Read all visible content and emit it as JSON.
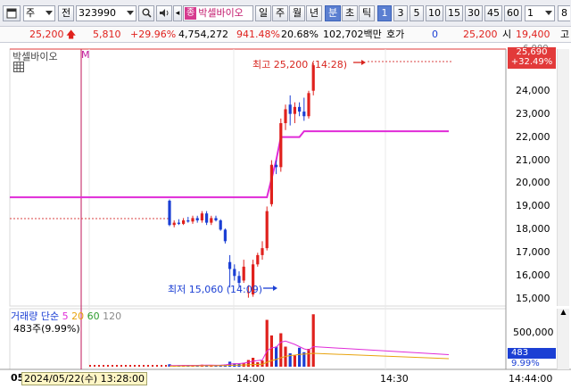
{
  "toolbar": {
    "market": "주",
    "chart_type": "전",
    "code": "323990",
    "sector_tag": "종",
    "stock_name": "박셀바이오",
    "periods": [
      "일",
      "주",
      "월",
      "년",
      "분",
      "초",
      "틱"
    ],
    "active_period": "분",
    "intervals": [
      "1",
      "3",
      "5",
      "10",
      "15",
      "30",
      "45",
      "60"
    ],
    "active_interval": "1",
    "multiplier": "1",
    "extra": "8"
  },
  "quote": {
    "price": "25,200",
    "change": "5,810",
    "change_pct": "+29.96%",
    "volume": "4,754,272",
    "vol_ratio": "941.48%",
    "turnover": "20.68%",
    "amount": "102,702백만",
    "hoga_label": "호가",
    "hoga_value": "0",
    "hoga_price": "25,200",
    "open_label": "시",
    "open_value": "19,400",
    "high_label": "고"
  },
  "chart": {
    "legend_name": "박셀바이오",
    "legend_flag": "M",
    "high_annotation": "최고 25,200 (14:28)",
    "low_annotation": "최저 15,060 (14:09)",
    "price_ticks": [
      "24,000",
      "23,000",
      "22,000",
      "21,000",
      "20,000",
      "19,000",
      "18,000",
      "17,000",
      "16,000",
      "15,000"
    ],
    "current_price_box": "25,690",
    "current_pct_box": "+32.49%",
    "top_partial_tick": "6,000",
    "volume_title": "거래량",
    "volume_ma_label": "단순",
    "volume_ma_periods": [
      "5",
      "20",
      "60",
      "120"
    ],
    "volume_ma_colors": [
      "#e02bd8",
      "#e8a30e",
      "#2e9c2e",
      "#8a8a8a"
    ],
    "volume_info": "483주(9.99%)",
    "volume_tick": "500,000",
    "volume_box": "483",
    "volume_box_pct": "9.99%",
    "time_ticks": [
      "14:00",
      "14:30",
      "14:44:00"
    ],
    "time_prefix": "05",
    "date_box": "2024/05/22(수) 13:28:00"
  },
  "colors": {
    "up": "#e0211d",
    "down": "#1b3fd4",
    "ma_line": "#e02bd8",
    "crosshair": "#c0145a"
  },
  "chart_data": {
    "type": "candlestick",
    "unit": "KRW",
    "ylim": [
      14700,
      25800
    ],
    "candles": [
      {
        "o": 19250,
        "h": 19300,
        "l": 18150,
        "c": 18200
      },
      {
        "o": 18200,
        "h": 18400,
        "l": 18100,
        "c": 18300
      },
      {
        "o": 18300,
        "h": 18450,
        "l": 18200,
        "c": 18250
      },
      {
        "o": 18250,
        "h": 18500,
        "l": 18200,
        "c": 18400
      },
      {
        "o": 18400,
        "h": 18550,
        "l": 18300,
        "c": 18350
      },
      {
        "o": 18350,
        "h": 18600,
        "l": 18250,
        "c": 18500
      },
      {
        "o": 18500,
        "h": 18600,
        "l": 18300,
        "c": 18400
      },
      {
        "o": 18400,
        "h": 18800,
        "l": 18300,
        "c": 18700
      },
      {
        "o": 18700,
        "h": 18800,
        "l": 18200,
        "c": 18300
      },
      {
        "o": 18300,
        "h": 18600,
        "l": 18200,
        "c": 18500
      },
      {
        "o": 18500,
        "h": 18600,
        "l": 18350,
        "c": 18400
      },
      {
        "o": 18400,
        "h": 18450,
        "l": 17950,
        "c": 18000
      },
      {
        "o": 18000,
        "h": 18050,
        "l": 17400,
        "c": 17500
      },
      {
        "o": 16600,
        "h": 16900,
        "l": 15500,
        "c": 16300
      },
      {
        "o": 16300,
        "h": 16500,
        "l": 15800,
        "c": 16000
      },
      {
        "o": 16000,
        "h": 16200,
        "l": 15500,
        "c": 15700
      },
      {
        "o": 15800,
        "h": 16700,
        "l": 15700,
        "c": 16400
      },
      {
        "o": 15300,
        "h": 15600,
        "l": 15060,
        "c": 15300
      },
      {
        "o": 15200,
        "h": 16700,
        "l": 15100,
        "c": 16500
      },
      {
        "o": 16500,
        "h": 17000,
        "l": 16400,
        "c": 16900
      },
      {
        "o": 16900,
        "h": 17500,
        "l": 16700,
        "c": 17200
      },
      {
        "o": 17200,
        "h": 19000,
        "l": 17100,
        "c": 18800
      },
      {
        "o": 19100,
        "h": 21000,
        "l": 19000,
        "c": 20800
      },
      {
        "o": 20800,
        "h": 21000,
        "l": 20400,
        "c": 20700
      },
      {
        "o": 20700,
        "h": 22800,
        "l": 20500,
        "c": 22600
      },
      {
        "o": 22600,
        "h": 23400,
        "l": 22300,
        "c": 23200
      },
      {
        "o": 23400,
        "h": 23800,
        "l": 22500,
        "c": 23000
      },
      {
        "o": 23000,
        "h": 23500,
        "l": 22600,
        "c": 23300
      },
      {
        "o": 23300,
        "h": 23500,
        "l": 22900,
        "c": 23100
      },
      {
        "o": 23100,
        "h": 23700,
        "l": 22700,
        "c": 22900
      },
      {
        "o": 22900,
        "h": 24000,
        "l": 22800,
        "c": 23900
      },
      {
        "o": 24000,
        "h": 25200,
        "l": 23800,
        "c": 25100
      }
    ],
    "ma_steps": [
      {
        "x": 0,
        "v": 19400
      },
      {
        "x": 21,
        "v": 19400
      },
      {
        "x": 23,
        "v": 21000
      },
      {
        "x": 24,
        "v": 22000
      },
      {
        "x": 28,
        "v": 22000
      },
      {
        "x": 29,
        "v": 22250
      },
      {
        "x": 34,
        "v": 22250
      }
    ],
    "volume": [
      22,
      8,
      10,
      12,
      14,
      10,
      12,
      18,
      15,
      10,
      12,
      14,
      20,
      45,
      30,
      25,
      35,
      60,
      80,
      40,
      55,
      420,
      280,
      180,
      300,
      180,
      120,
      100,
      170,
      130,
      160,
      470
    ],
    "volume_ma": [
      10,
      10,
      11,
      12,
      12,
      12,
      12,
      13,
      14,
      14,
      13,
      14,
      16,
      24,
      26,
      28,
      32,
      40,
      50,
      55,
      60,
      140,
      170,
      175,
      220,
      230,
      215,
      200,
      180,
      160,
      150,
      180
    ],
    "volume_ma2": [
      5,
      5,
      6,
      6,
      7,
      7,
      8,
      8,
      9,
      9,
      9,
      10,
      10,
      12,
      13,
      14,
      15,
      17,
      19,
      20,
      22,
      40,
      55,
      65,
      80,
      92,
      100,
      104,
      110,
      113,
      116,
      120
    ]
  }
}
